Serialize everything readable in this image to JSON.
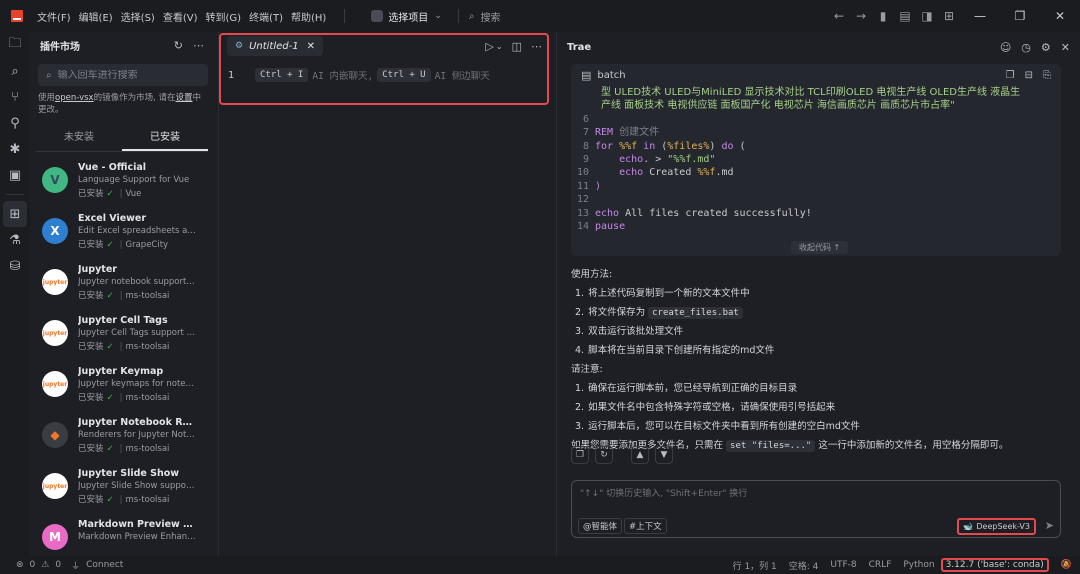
{
  "titlebar": {
    "menus": [
      "文件(F)",
      "编辑(E)",
      "选择(S)",
      "查看(V)",
      "转到(G)",
      "终端(T)",
      "帮助(H)"
    ],
    "project_label": "选择项目",
    "search_label": "搜索"
  },
  "sidebar": {
    "title": "插件市场",
    "search_placeholder": "输入回车进行搜索",
    "notice_prefix": "使用",
    "notice_link": "open-vsx",
    "notice_middle": "的镜像作为市场, 请在",
    "notice_link2": "设置",
    "notice_suffix": "中更改。",
    "tabs": [
      "未安装",
      "已安装"
    ],
    "extensions": [
      {
        "name": "Vue - Official",
        "desc": "Language Support for Vue",
        "status": "已安装",
        "publisher": "Vue",
        "icon_color": "#41b883",
        "icon_text": "V",
        "icon_fg": "#35495e"
      },
      {
        "name": "Excel Viewer",
        "desc": "Edit Excel spreadsheets and...",
        "status": "已安装",
        "publisher": "GrapeCity",
        "icon_color": "#2f7fd1",
        "icon_text": "X",
        "icon_fg": "#ffffff"
      },
      {
        "name": "Jupyter",
        "desc": "Jupyter notebook support, i...",
        "status": "已安装",
        "publisher": "ms-toolsai",
        "icon_color": "#ffffff",
        "icon_text": "jupyter",
        "icon_fg": "#f37726"
      },
      {
        "name": "Jupyter Cell Tags",
        "desc": "Jupyter Cell Tags support fo...",
        "status": "已安装",
        "publisher": "ms-toolsai",
        "icon_color": "#ffffff",
        "icon_text": "jupyter",
        "icon_fg": "#f37726"
      },
      {
        "name": "Jupyter Keymap",
        "desc": "Jupyter keymaps for noteb...",
        "status": "已安装",
        "publisher": "ms-toolsai",
        "icon_color": "#ffffff",
        "icon_text": "jupyter",
        "icon_fg": "#f37726"
      },
      {
        "name": "Jupyter Notebook Ren...",
        "desc": "Renderers for Jupyter Note...",
        "status": "已安装",
        "publisher": "ms-toolsai",
        "icon_color": "#3a3c44",
        "icon_text": "◆",
        "icon_fg": "#f37726"
      },
      {
        "name": "Jupyter Slide Show",
        "desc": "Jupyter Slide Show support ...",
        "status": "已安装",
        "publisher": "ms-toolsai",
        "icon_color": "#ffffff",
        "icon_text": "jupyter",
        "icon_fg": "#f37726"
      },
      {
        "name": "Markdown Preview Enh...",
        "desc": "Markdown Preview Enhanc...",
        "status": "",
        "publisher": "",
        "icon_color": "#e96bc5",
        "icon_text": "M",
        "icon_fg": "#ffffff"
      }
    ]
  },
  "editor": {
    "tab_name": "Untitled-1",
    "line_number": "1",
    "kbd1": "Ctrl + I",
    "hint1": "AI 内嵌聊天,",
    "kbd2": "Ctrl + U",
    "hint2": "AI 侧边聊天"
  },
  "chat": {
    "title": "Trae",
    "code_lang": "batch",
    "code_wrap": "型 ULED技术 ULED与MiniLED 显示技术对比 TCL印刷OLED 电视生产线 OLED生产线 液晶生产线 面板技术 电视供应链 面板国产化 电视芯片 海信画质芯片 画质芯片市占率\"",
    "collapse_label": "收起代码 ↑",
    "usage_title": "使用方法:",
    "usage_steps": [
      "将上述代码复制到一个新的文本文件中",
      "将文件保存为",
      "双击运行该批处理文件",
      "脚本将在当前目录下创建所有指定的md文件"
    ],
    "usage_step2_code": "create_files.bat",
    "notes_title": "请注意:",
    "notes": [
      "确保在运行脚本前，您已经导航到正确的目标目录",
      "如果文件名中包含特殊字符或空格，请确保使用引号括起来",
      "运行脚本后，您可以在目标文件夹中看到所有创建的空白md文件"
    ],
    "footer_prefix": "如果您需要添加更多文件名，只需在",
    "footer_code": "set \"files=...\"",
    "footer_suffix": "这一行中添加新的文件名，用空格分隔即可。",
    "input_placeholder": "\"↑↓\" 切换历史输入, \"Shift+Enter\" 换行",
    "chip_agent": "@智能体",
    "chip_context": "#上下文",
    "model": "DeepSeek-V3"
  },
  "statusbar": {
    "errors": "0",
    "warnings": "0",
    "connect": "Connect",
    "position": "行 1，列 1",
    "spaces": "空格: 4",
    "encoding": "UTF-8",
    "eol": "CRLF",
    "language": "Python",
    "env": "3.12.7 ('base': conda)"
  }
}
